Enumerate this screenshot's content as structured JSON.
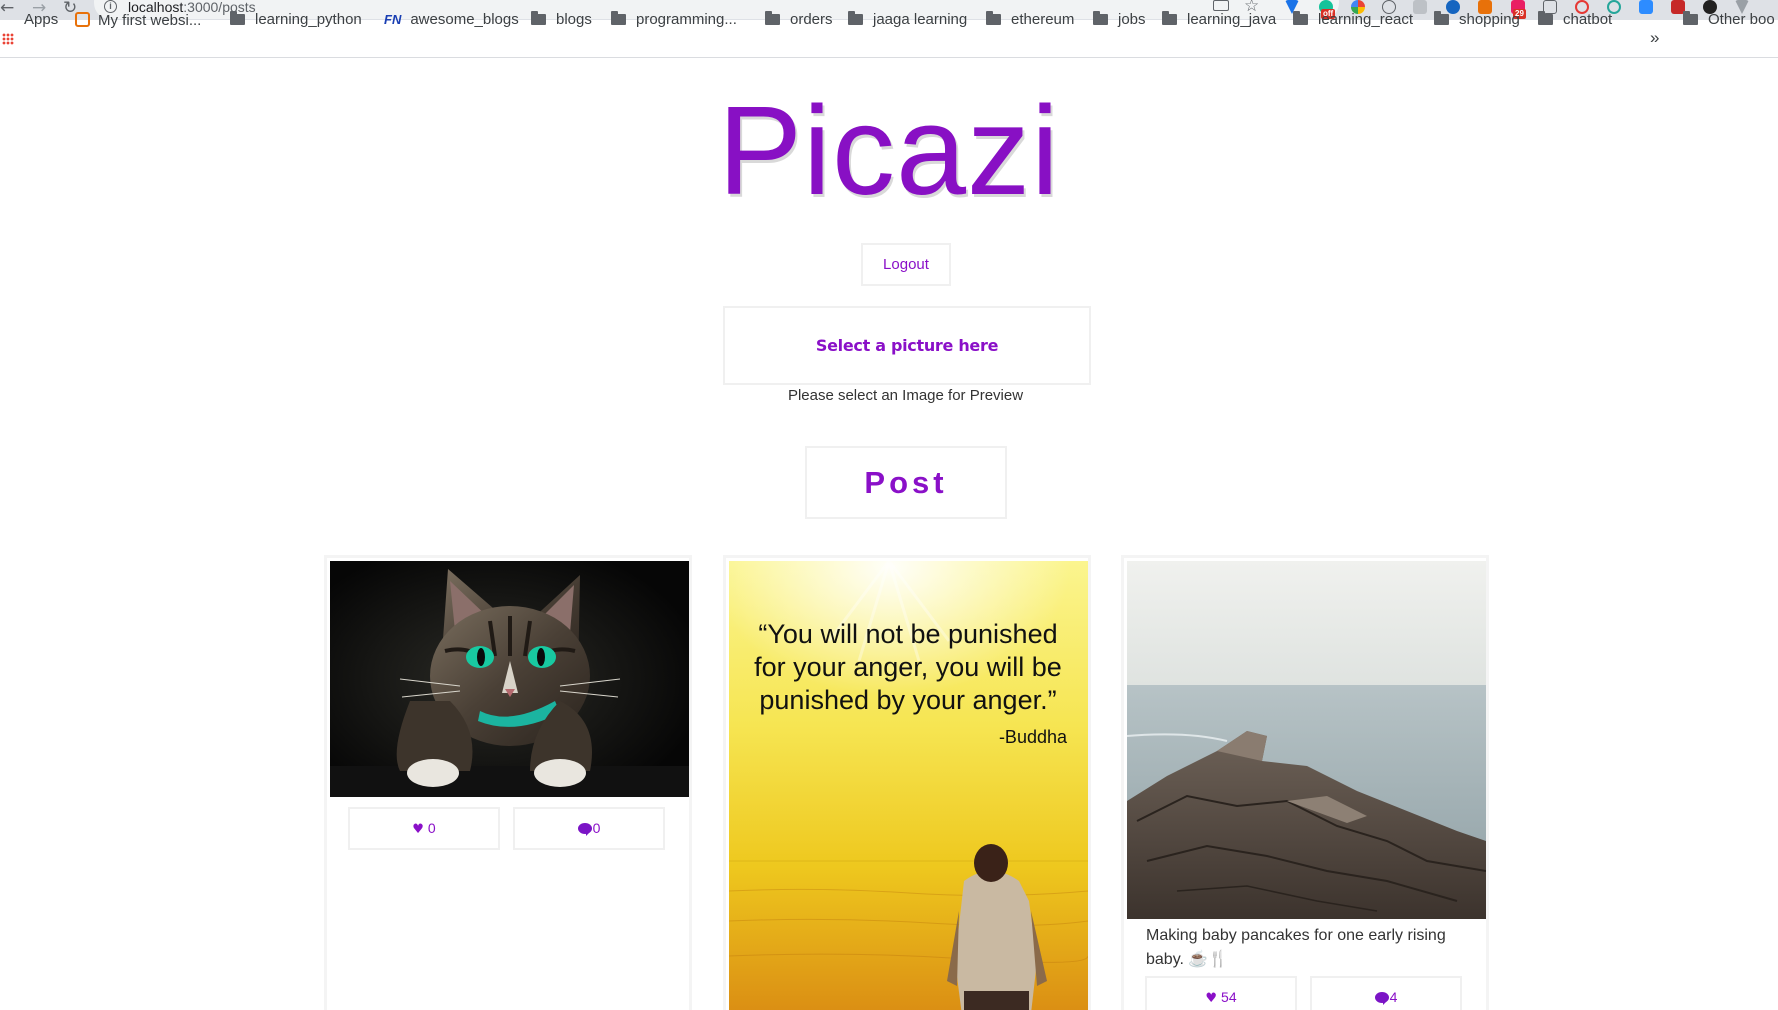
{
  "browser": {
    "url_host": "localhost",
    "url_path": ":3000/posts",
    "bookmarks": [
      {
        "label": "Apps",
        "icon": "apps-grid-icon"
      },
      {
        "label": "My first websi...",
        "icon": "site-favicon"
      },
      {
        "label": "learning_python",
        "icon": "folder-icon"
      },
      {
        "label": "awesome_blogs",
        "icon": "fn-favicon"
      },
      {
        "label": "blogs",
        "icon": "folder-icon"
      },
      {
        "label": "programming...",
        "icon": "folder-icon"
      },
      {
        "label": "orders",
        "icon": "folder-icon"
      },
      {
        "label": "jaaga learning",
        "icon": "folder-icon"
      },
      {
        "label": "ethereum",
        "icon": "folder-icon"
      },
      {
        "label": "jobs",
        "icon": "folder-icon"
      },
      {
        "label": "learning_java",
        "icon": "folder-icon"
      },
      {
        "label": "learning_react",
        "icon": "folder-icon"
      },
      {
        "label": "shopping",
        "icon": "folder-icon"
      },
      {
        "label": "chatbot",
        "icon": "folder-icon"
      }
    ],
    "overflow_glyph": "»",
    "other_bookmarks": "Other boo",
    "extension_badges": [
      "off",
      "29"
    ]
  },
  "app": {
    "title": "Picazi",
    "logout_label": "Logout",
    "select_picture_label": "Select a picture here",
    "preview_note": "Please select an Image for Preview",
    "post_label": "Post",
    "accent_color": "#8a10c8"
  },
  "posts": [
    {
      "image": "cat-photo",
      "caption": "",
      "likes": "0",
      "comments": "0"
    },
    {
      "image": "buddha-quote-photo",
      "quote": "“You will not be punished for your anger, you will be punished by your anger.”",
      "quote_author": "-Buddha",
      "caption": "",
      "likes": "",
      "comments": ""
    },
    {
      "image": "rocky-coast-photo",
      "caption": "Making baby pancakes for one early rising baby. ☕🍴",
      "likes": "54",
      "comments": "4"
    }
  ]
}
